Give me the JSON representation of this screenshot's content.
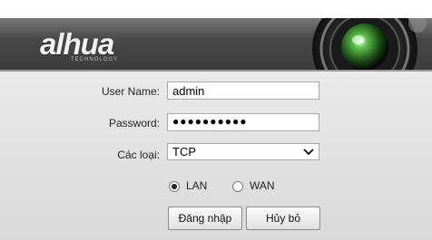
{
  "brand": {
    "logo_text": "alhua",
    "logo_sub": "TECHNOLOGY"
  },
  "login": {
    "username_label": "User Name:",
    "username_value": "admin",
    "password_label": "Password:",
    "password_value": "●●●●●●●●●●",
    "type_label": "Các loại:",
    "type_value": "TCP",
    "network_options": [
      {
        "label": "LAN",
        "selected": true
      },
      {
        "label": "WAN",
        "selected": false
      }
    ],
    "login_button": "Đăng nhập",
    "cancel_button": "Hủy bỏ"
  },
  "colors": {
    "banner": "#474747",
    "dialog_bg": "#e3e3e3"
  }
}
